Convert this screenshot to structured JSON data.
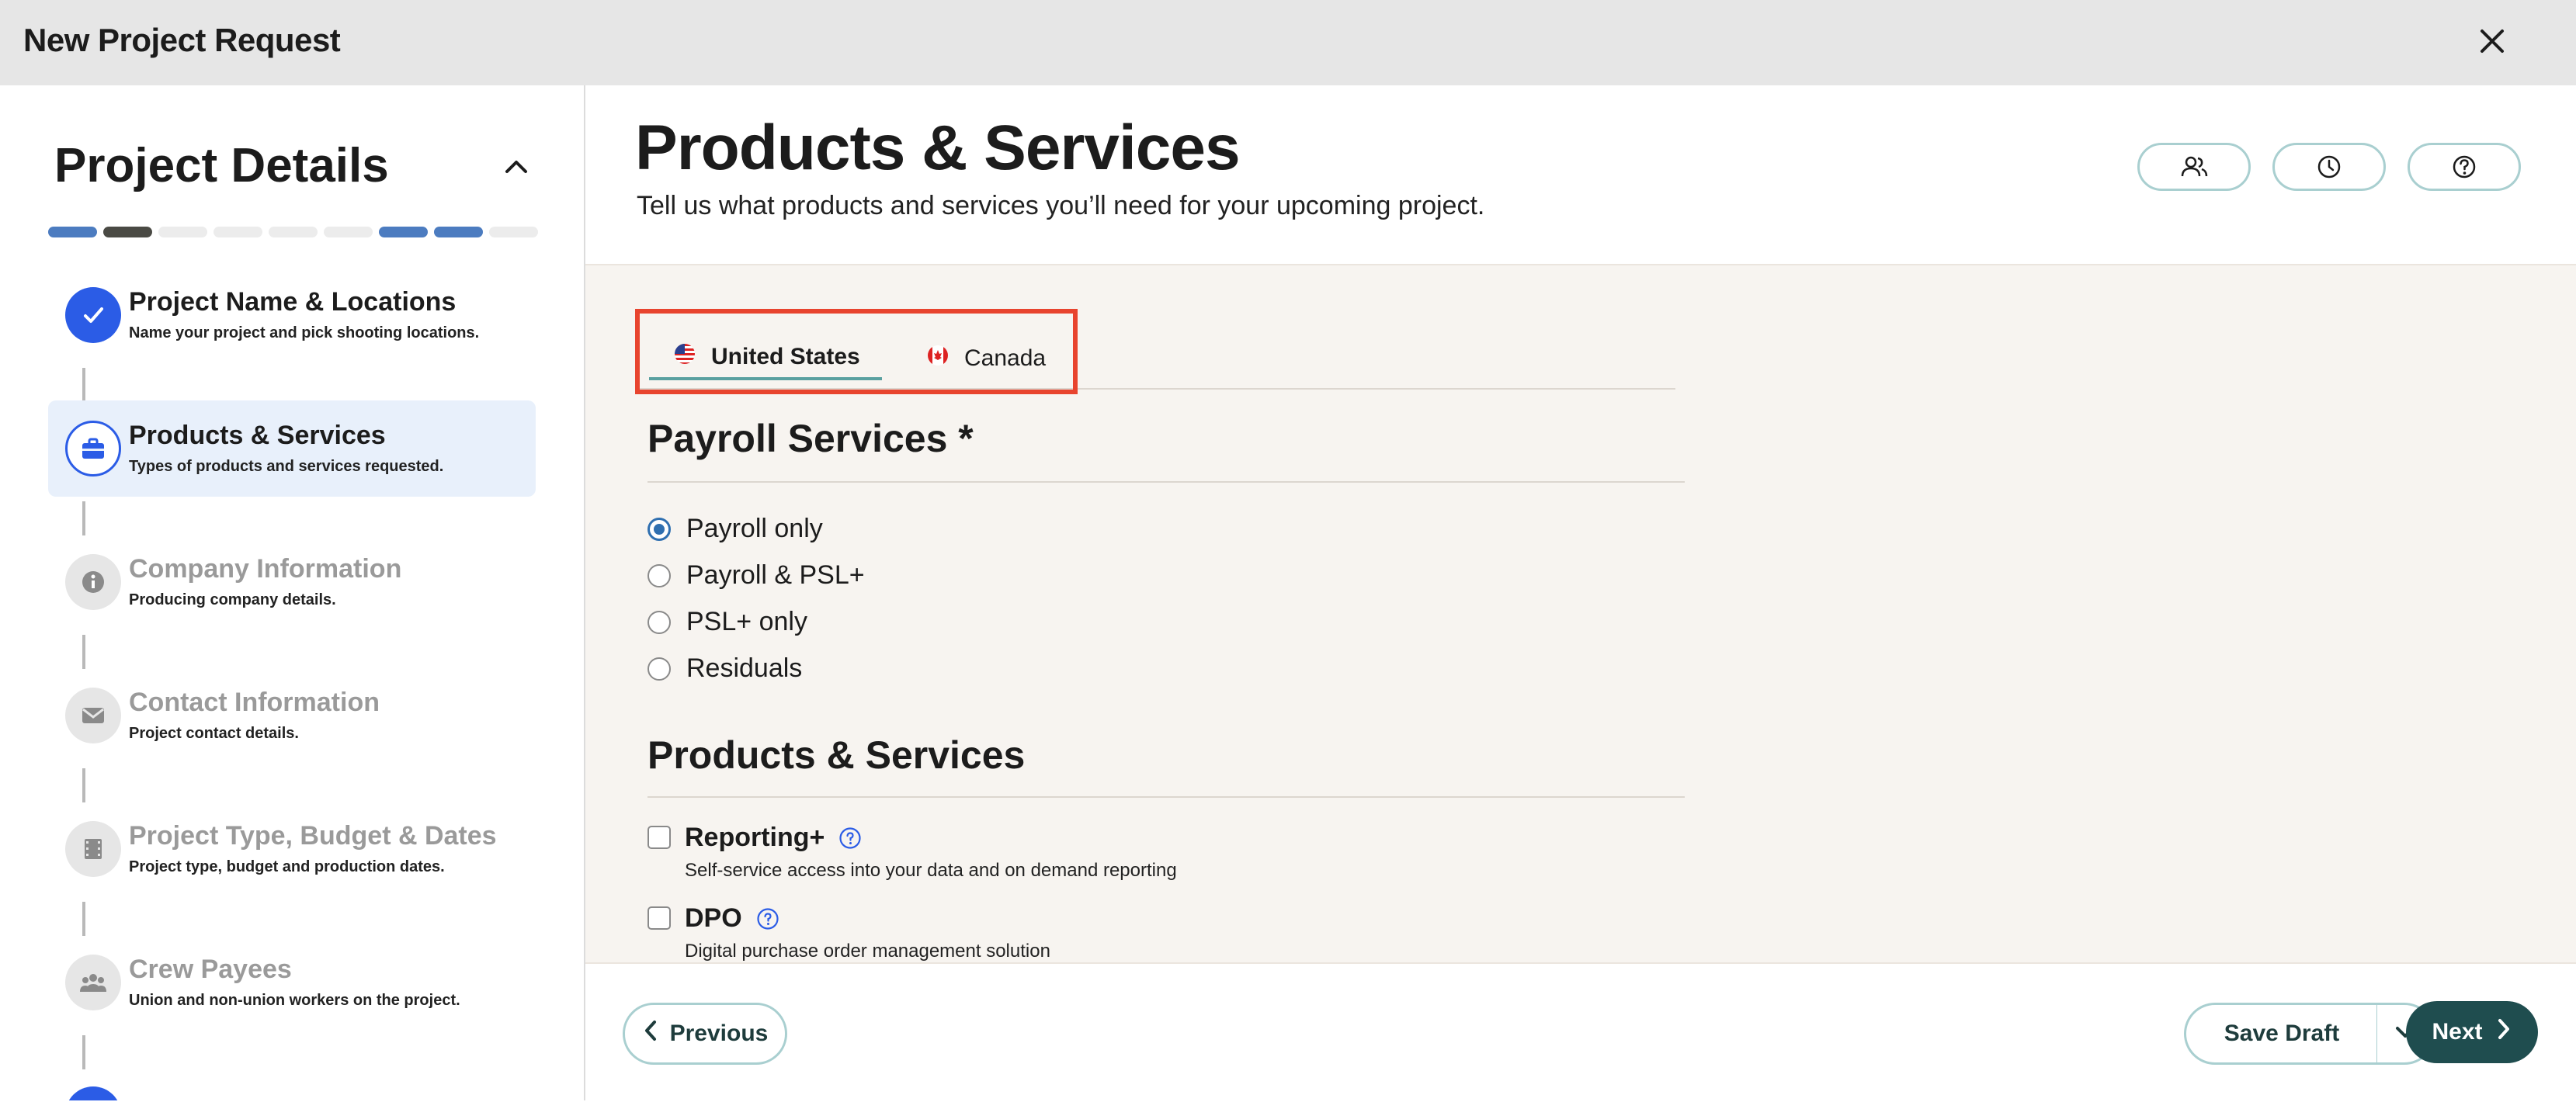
{
  "window": {
    "title": "New Project Request",
    "close_icon": "close-icon"
  },
  "sidebar": {
    "title": "Project Details",
    "progress": [
      "#4c7cc0",
      "#4a4a44",
      "#ececec",
      "#ececec",
      "#ececec",
      "#ececec",
      "#4c7cc0",
      "#4c7cc0",
      "#ececec"
    ],
    "steps": [
      {
        "title": "Project Name & Locations",
        "subtitle": "Name your project and pick shooting locations.",
        "icon": "check-icon",
        "state": "complete"
      },
      {
        "title": "Products & Services",
        "subtitle": "Types of products and services requested.",
        "icon": "briefcase-icon",
        "state": "active"
      },
      {
        "title": "Company Information",
        "subtitle": "Producing company details.",
        "icon": "info-icon",
        "state": "pending"
      },
      {
        "title": "Contact Information",
        "subtitle": "Project contact details.",
        "icon": "envelope-icon",
        "state": "pending"
      },
      {
        "title": "Project Type, Budget & Dates",
        "subtitle": "Project type, budget and production dates.",
        "icon": "film-icon",
        "state": "pending"
      },
      {
        "title": "Crew Payees",
        "subtitle": "Union and non-union workers on the project.",
        "icon": "people-icon",
        "state": "pending"
      }
    ]
  },
  "main": {
    "title": "Products & Services",
    "subtitle": "Tell us what products and services you’ll need for your upcoming project.",
    "header_buttons": [
      "users-icon",
      "clock-icon",
      "help-icon"
    ],
    "tabs": [
      {
        "label": "United States",
        "icon": "us-flag-icon",
        "selected": true
      },
      {
        "label": "Canada",
        "icon": "canada-flag-icon",
        "selected": false
      }
    ],
    "payroll": {
      "title": "Payroll Services *",
      "options": [
        "Payroll only",
        "Payroll & PSL+",
        "PSL+ only",
        "Residuals"
      ],
      "selected": "Payroll only"
    },
    "products": {
      "title": "Products & Services",
      "items": [
        {
          "label": "Reporting+",
          "description": "Self-service access into your data and on demand reporting",
          "checked": false
        },
        {
          "label": "DPO",
          "description": "Digital purchase order management solution",
          "checked": false
        }
      ]
    }
  },
  "footer": {
    "previous_label": "Previous",
    "save_draft_label": "Save Draft",
    "next_label": "Next"
  },
  "colors": {
    "accent": "#2b5ce6",
    "highlight": "#e8442e",
    "next_bg": "#1f4d4f",
    "outline": "#a9cfd0"
  }
}
